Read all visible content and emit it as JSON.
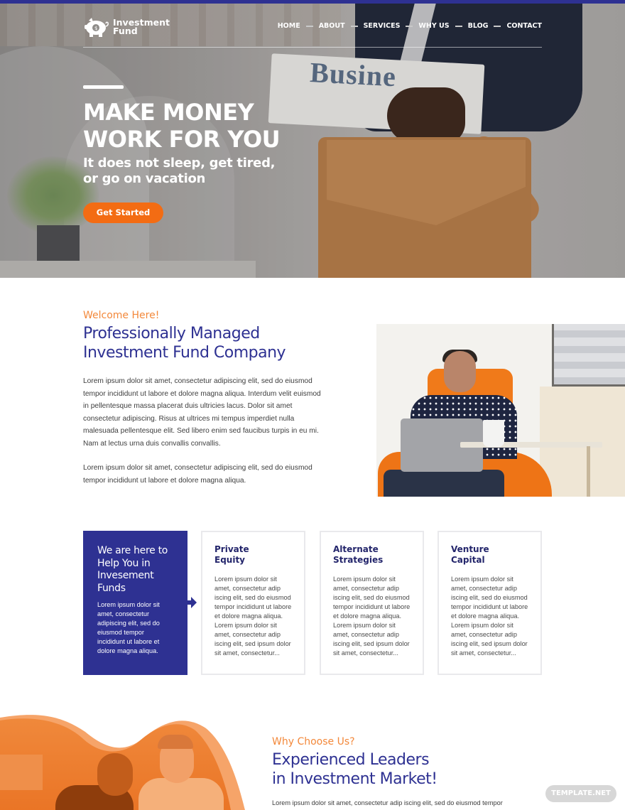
{
  "brand": {
    "name_line1": "Investment",
    "name_line2": "Fund",
    "logo_icon": "piggy-bank-icon",
    "colors": {
      "primary": "#2e3192",
      "accent": "#f36c13",
      "eyebrow": "#f3883a"
    }
  },
  "nav": {
    "items": [
      {
        "label": "HOME"
      },
      {
        "label": "ABOUT"
      },
      {
        "label": "SERVICES"
      },
      {
        "label": "WHY US"
      },
      {
        "label": "BLOG"
      },
      {
        "label": "CONTACT"
      }
    ]
  },
  "hero": {
    "title_line1": "MAKE MONEY",
    "title_line2": "WORK FOR YOU",
    "subtitle_line1": "It does not sleep, get tired,",
    "subtitle_line2": "or go on vacation",
    "cta_label": "Get Started",
    "newspaper_headline": "Busine"
  },
  "welcome": {
    "eyebrow": "Welcome Here!",
    "title_line1": "Professionally Managed",
    "title_line2": "Investment Fund Company",
    "paragraph1": "Lorem ipsum dolor sit amet, consectetur adipiscing elit, sed do eiusmod tempor incididunt ut labore et dolore magna aliqua. Interdum velit euismod in pellentesque massa placerat duis ultricies lacus. Dolor sit amet consectetur adipiscing. Risus at ultrices mi tempus imperdiet nulla malesuada pellentesque elit. Sed libero enim sed faucibus turpis in eu mi. Nam at lectus urna duis convallis convallis.",
    "paragraph2": "Lorem ipsum dolor sit amet, consectetur adipiscing elit, sed do eiusmod tempor incididunt ut labore et dolore magna aliqua."
  },
  "services": {
    "help": {
      "title": "We are here to Help You in Invesement Funds",
      "text": "Lorem ipsum dolor sit amet, consectetur adipiscing elit, sed do eiusmod tempor incididunt ut labore et dolore magna aliqua."
    },
    "cards": [
      {
        "title_line1": "Private",
        "title_line2": "Equity",
        "text": "Lorem ipsum dolor sit amet, consectetur adip iscing elit, sed do eiusmod tempor incididunt ut labore et dolore magna aliqua. Lorem ipsum dolor sit amet, consectetur adip iscing elit, sed ipsum dolor sit amet, consectetur..."
      },
      {
        "title_line1": "Alternate",
        "title_line2": "Strategies",
        "text": "Lorem ipsum dolor sit amet, consectetur adip iscing elit, sed do eiusmod tempor incididunt ut labore et dolore magna aliqua. Lorem ipsum dolor sit amet, consectetur adip iscing elit, sed ipsum dolor sit amet, consectetur..."
      },
      {
        "title_line1": "Venture",
        "title_line2": "Capital",
        "text": "Lorem ipsum dolor sit amet, consectetur adip iscing elit, sed do eiusmod tempor incididunt ut labore et dolore magna aliqua. Lorem ipsum dolor sit amet, consectetur adip iscing elit, sed ipsum dolor sit amet, consectetur..."
      }
    ]
  },
  "why": {
    "eyebrow": "Why Choose Us?",
    "title_line1": "Experienced Leaders",
    "title_line2": "in Investment Market!",
    "paragraph": "Lorem ipsum dolor sit amet, consectetur adip iscing elit, sed do eiusmod tempor"
  },
  "watermark": "TEMPLATE.NET"
}
